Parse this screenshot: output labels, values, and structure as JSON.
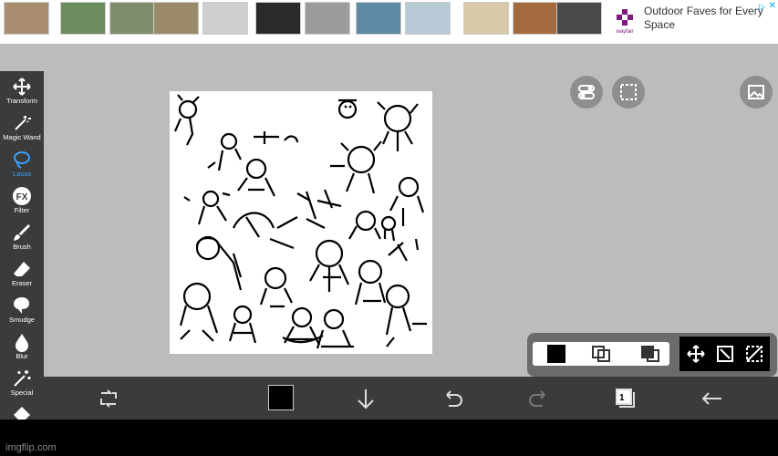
{
  "ad": {
    "text": "Outdoor Faves for Every Space",
    "brand": "wayfair",
    "adchoices_icon": "play-triangle-icon",
    "close_icon": "x-icon",
    "thumbnails": [
      "gazebo",
      "house",
      "shed",
      "gazebo-dark",
      "storage-box",
      "fire-pit-cover",
      "hot-tub",
      "dome-tent",
      "fence",
      "garden-shed",
      "patio-chair"
    ]
  },
  "sidebar": {
    "tools": [
      {
        "label": "Transform",
        "icon": "move-arrows-icon"
      },
      {
        "label": "Magic Wand",
        "icon": "magic-wand-icon"
      },
      {
        "label": "Lasso",
        "icon": "lasso-icon",
        "active": true
      },
      {
        "label": "Filter",
        "icon": "fx-icon"
      },
      {
        "label": "Brush",
        "icon": "brush-icon"
      },
      {
        "label": "Eraser",
        "icon": "eraser-icon"
      },
      {
        "label": "Smudge",
        "icon": "smudge-icon"
      },
      {
        "label": "Blur",
        "icon": "droplet-icon"
      },
      {
        "label": "Special",
        "icon": "sparkle-wand-icon"
      }
    ]
  },
  "canvas": {
    "content": "sketch-doodles"
  },
  "top_buttons": [
    "toggle-icon",
    "selection-icon",
    "image-icon"
  ],
  "color_panel": {
    "primary_color": "#000000",
    "icons": [
      "layer-copy-icon",
      "layer-merge-icon",
      "move-icon",
      "transform-icon",
      "deselect-icon"
    ]
  },
  "bottom_bar": {
    "icons": [
      "rotate-icon",
      "color-swatch",
      "down-arrow-icon",
      "undo-icon",
      "redo-icon",
      "layers-icon",
      "back-arrow-icon"
    ],
    "layer_count": "1",
    "current_color": "#000000"
  },
  "watermark": "imgflip.com",
  "colors": {
    "accent": "#3aa2ff",
    "panel": "#3b3b3b",
    "background": "#bcbcbc"
  }
}
